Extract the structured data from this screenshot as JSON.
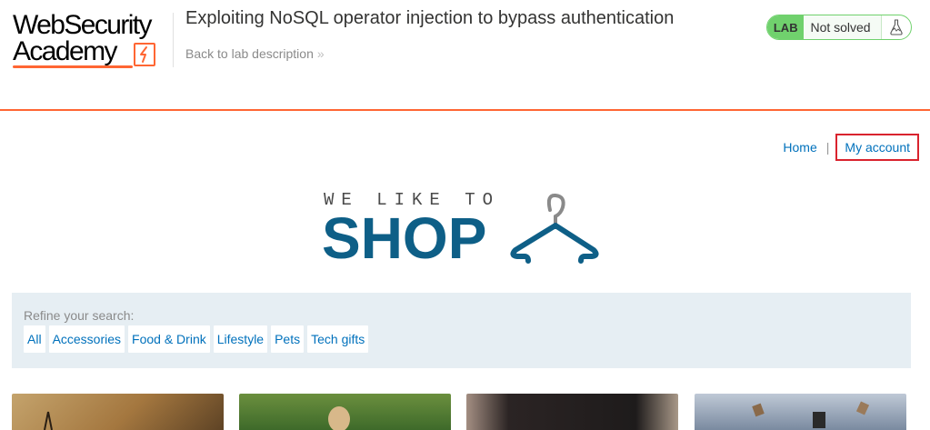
{
  "logo": {
    "line1": "WebSecurity",
    "line2": "Academy"
  },
  "lab": {
    "title": "Exploiting NoSQL operator injection to bypass authentication",
    "back_link": "Back to lab description",
    "back_chevron": "»"
  },
  "status": {
    "badge": "LAB",
    "text": "Not solved",
    "icon": "flask-icon",
    "color": "#70d16d"
  },
  "nav": {
    "home": "Home",
    "separator": "|",
    "account": "My account"
  },
  "shop_logo": {
    "small": "WE LIKE TO",
    "big": "SHOP",
    "icon": "hanger-icon"
  },
  "filter": {
    "caption": "Refine your search:",
    "categories": [
      "All",
      "Accessories",
      "Food & Drink",
      "Lifestyle",
      "Pets",
      "Tech gifts"
    ]
  },
  "colors": {
    "accent": "#ff6633",
    "link": "#0071bc",
    "shop_blue": "#0e5f87",
    "highlight_box": "#d9232e"
  }
}
